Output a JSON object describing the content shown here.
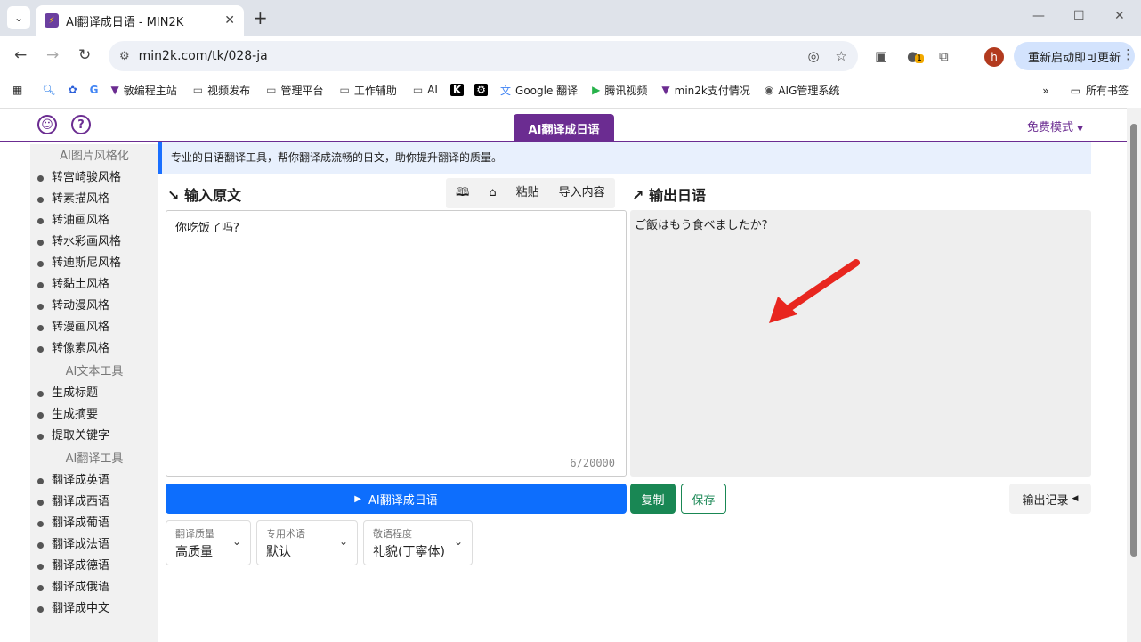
{
  "browser": {
    "tab_title": "AI翻译成日语 - MIN2K",
    "url": "min2k.com/tk/028-ja",
    "update_label": "重新启动即可更新",
    "avatar_letter": "h",
    "ext_badge": "1",
    "bookmarks": [
      {
        "label": "敏编程主站",
        "icon": "tool-icon"
      },
      {
        "label": "视频发布",
        "icon": "folder-icon"
      },
      {
        "label": "管理平台",
        "icon": "folder-icon"
      },
      {
        "label": "工作辅助",
        "icon": "folder-icon"
      },
      {
        "label": "AI",
        "icon": "folder-icon"
      },
      {
        "label": "Google 翻译",
        "icon": "translate-icon"
      },
      {
        "label": "腾讯视频",
        "icon": "video-icon"
      },
      {
        "label": "min2k支付情况",
        "icon": "tool-icon"
      },
      {
        "label": "AIG管理系统",
        "icon": "globe-icon"
      }
    ],
    "all_bookmarks": "所有书签"
  },
  "page": {
    "nav_tab": "AI翻译成日语",
    "free_mode": "免费模式",
    "banner": "专业的日语翻译工具，帮你翻译成流畅的日文，助你提升翻译的质量。",
    "input_title": "输入原文",
    "output_title": "输出日语",
    "tools": {
      "paste": "粘贴",
      "import": "导入内容"
    },
    "input_text": "你吃饭了吗?",
    "char_count": "6/20000",
    "output_text": "ご飯はもう食べましたか?",
    "translate_btn": "AI翻译成日语",
    "copy_btn": "复制",
    "save_btn": "保存",
    "history_btn": "输出记录",
    "selects": [
      {
        "label": "翻译质量",
        "value": "高质量"
      },
      {
        "label": "专用术语",
        "value": "默认"
      },
      {
        "label": "敬语程度",
        "value": "礼貌(丁寧体)"
      }
    ]
  },
  "sidebar": {
    "groups": [
      {
        "head": "AI图片风格化",
        "items": [
          "转宫崎骏风格",
          "转素描风格",
          "转油画风格",
          "转水彩画风格",
          "转迪斯尼风格",
          "转黏土风格",
          "转动漫风格",
          "转漫画风格",
          "转像素风格"
        ]
      },
      {
        "head": "AI文本工具",
        "items": [
          "生成标题",
          "生成摘要",
          "提取关键字"
        ]
      },
      {
        "head": "AI翻译工具",
        "items": [
          "翻译成英语",
          "翻译成西语",
          "翻译成葡语",
          "翻译成法语",
          "翻译成德语",
          "翻译成俄语",
          "翻译成中文"
        ]
      }
    ]
  },
  "colors": {
    "brand": "#6b2c91",
    "primary": "#0d6efd",
    "success": "#198754",
    "arrow": "#e8261f"
  }
}
